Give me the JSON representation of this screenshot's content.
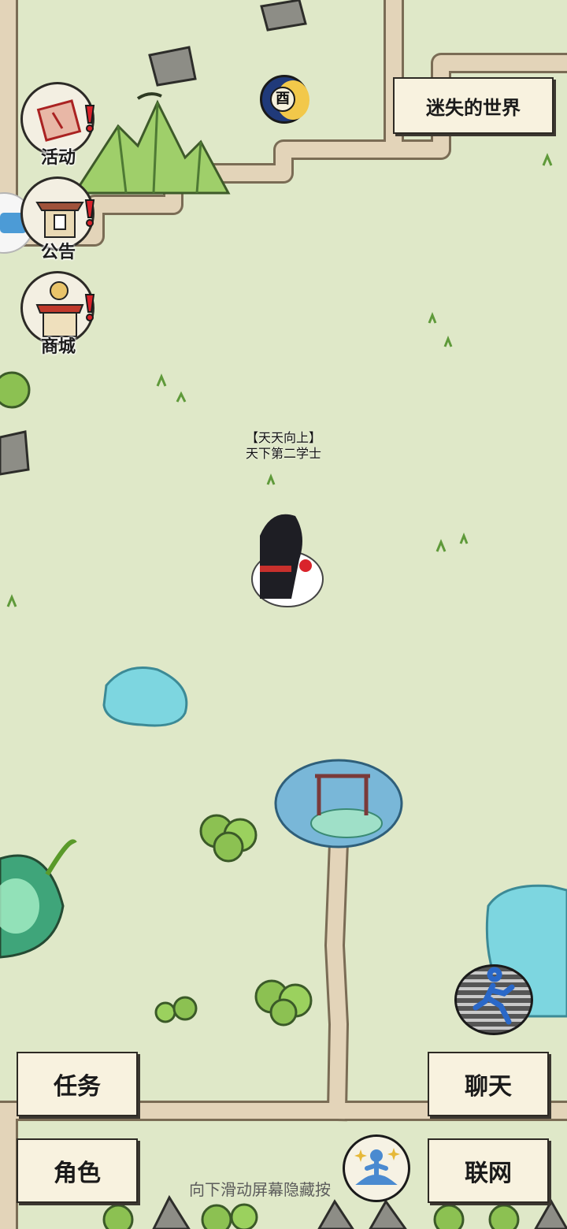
{
  "location": {
    "title": "迷失的世界"
  },
  "side_menu": [
    {
      "label": "活动",
      "icon": "scroll-icon"
    },
    {
      "label": "公告",
      "icon": "gate-icon"
    },
    {
      "label": "商城",
      "icon": "shop-icon"
    }
  ],
  "player": {
    "title_line": "【天天向上】",
    "name_line": "天下第二学士"
  },
  "time_badge": {
    "glyph": "酉"
  },
  "buttons": {
    "task": "任务",
    "role": "角色",
    "chat": "聊天",
    "network": "联网"
  },
  "hint": "向下滑动屏幕隐藏按",
  "colors": {
    "ground": "#dfe8c8",
    "path": "#e2d3b8",
    "button_bg": "#f8f2df",
    "alert": "#d9232b",
    "water": "#7dd6e0"
  }
}
